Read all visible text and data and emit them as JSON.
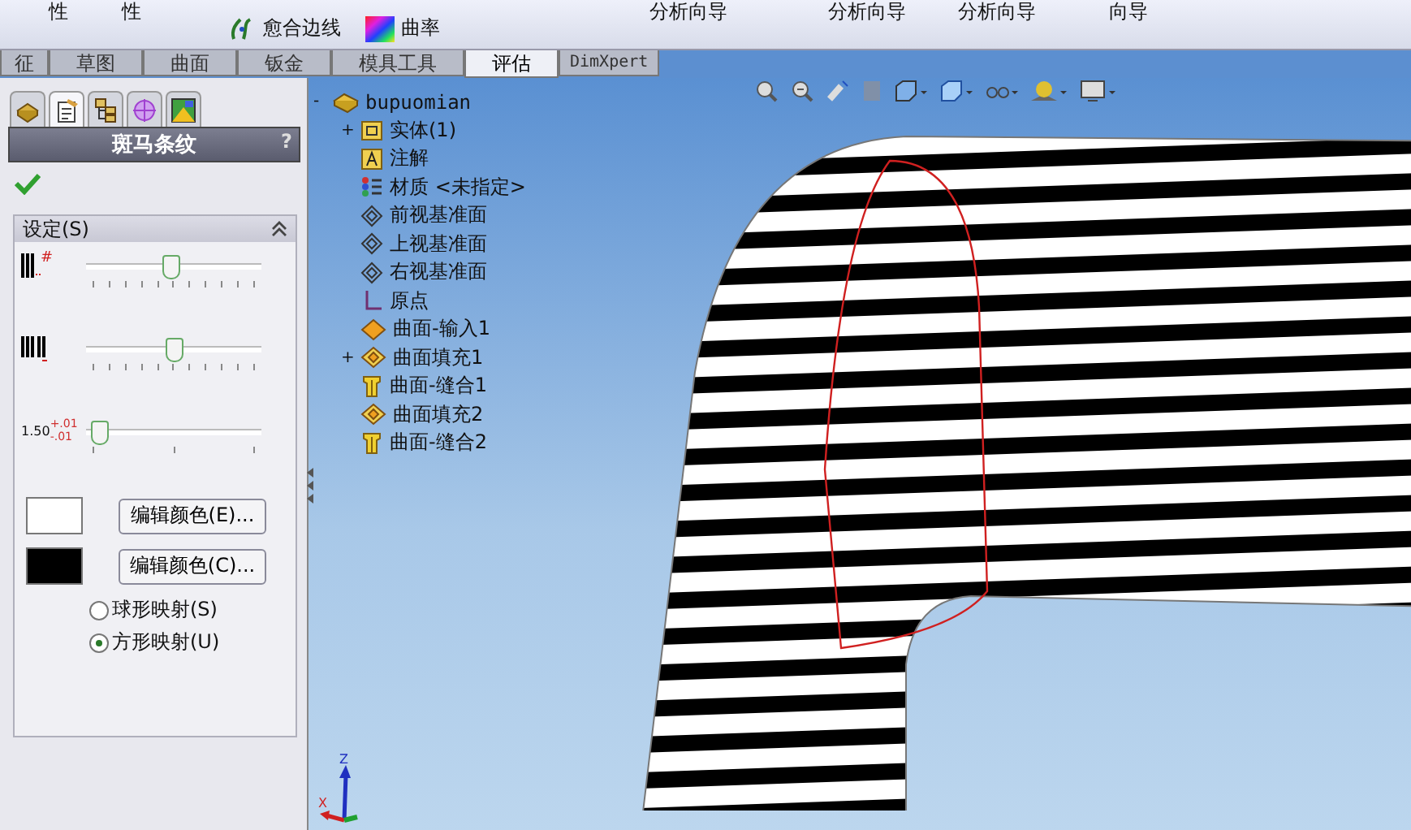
{
  "ribbon": {
    "labels": [
      {
        "kind": "text",
        "text": "性"
      },
      {
        "kind": "text",
        "text": "性"
      },
      {
        "kind": "heal",
        "text": "愈合边线"
      },
      {
        "kind": "curvature",
        "text": "曲率"
      },
      {
        "kind": "text",
        "text": "分析向导"
      },
      {
        "kind": "text",
        "text": "分析向导"
      },
      {
        "kind": "text",
        "text": "分析向导"
      },
      {
        "kind": "text",
        "text": "向导"
      }
    ]
  },
  "tabs": [
    {
      "label": "征",
      "selected": false
    },
    {
      "label": "草图",
      "selected": false
    },
    {
      "label": "曲面",
      "selected": false
    },
    {
      "label": "钣金",
      "selected": false
    },
    {
      "label": "模具工具",
      "selected": false
    },
    {
      "label": "评估",
      "selected": true
    },
    {
      "label": "DimXpert",
      "selected": false
    }
  ],
  "property_manager": {
    "tabs": [
      {
        "kind": "part",
        "selected": false
      },
      {
        "kind": "property",
        "selected": true
      },
      {
        "kind": "config",
        "selected": false
      },
      {
        "kind": "target",
        "selected": false
      },
      {
        "kind": "display",
        "selected": false
      }
    ],
    "title": "斑马条纹",
    "help": "?",
    "group": {
      "title": "设定(S)",
      "expanded": true
    },
    "sliders": [
      {
        "kind": "count",
        "mark": "#",
        "level": 0.48
      },
      {
        "kind": "width",
        "level": 0.5
      },
      {
        "kind": "precision",
        "value": "1.50",
        "plus": "+.01",
        "minus": "-.01",
        "level": 0.03
      }
    ],
    "colors": [
      {
        "color": "#ffffff",
        "button": "编辑颜色(E)..."
      },
      {
        "color": "#000000",
        "button": "编辑颜色(C)..."
      }
    ],
    "mapping": [
      {
        "label": "球形映射(S)",
        "selected": false
      },
      {
        "label": "方形映射(U)",
        "selected": true
      }
    ]
  },
  "tree": {
    "label": "bupuomian",
    "toggle": "-",
    "kind": "part",
    "children": [
      {
        "label": "实体(1)",
        "toggle": "+",
        "kind": "folder"
      },
      {
        "label": "注解",
        "kind": "annotation"
      },
      {
        "label": "材质 <未指定>",
        "kind": "material"
      },
      {
        "label": "前视基准面",
        "kind": "plane"
      },
      {
        "label": "上视基准面",
        "kind": "plane"
      },
      {
        "label": "右视基准面",
        "kind": "plane"
      },
      {
        "label": "原点",
        "kind": "origin"
      },
      {
        "label": "曲面-输入1",
        "kind": "import"
      },
      {
        "label": "曲面填充1",
        "toggle": "+",
        "kind": "fill"
      },
      {
        "label": "曲面-缝合1",
        "kind": "knit"
      },
      {
        "label": "曲面填充2",
        "kind": "fill"
      },
      {
        "label": "曲面-缝合2",
        "kind": "knit"
      }
    ]
  },
  "triad": {
    "z": "Z",
    "x": "X"
  }
}
